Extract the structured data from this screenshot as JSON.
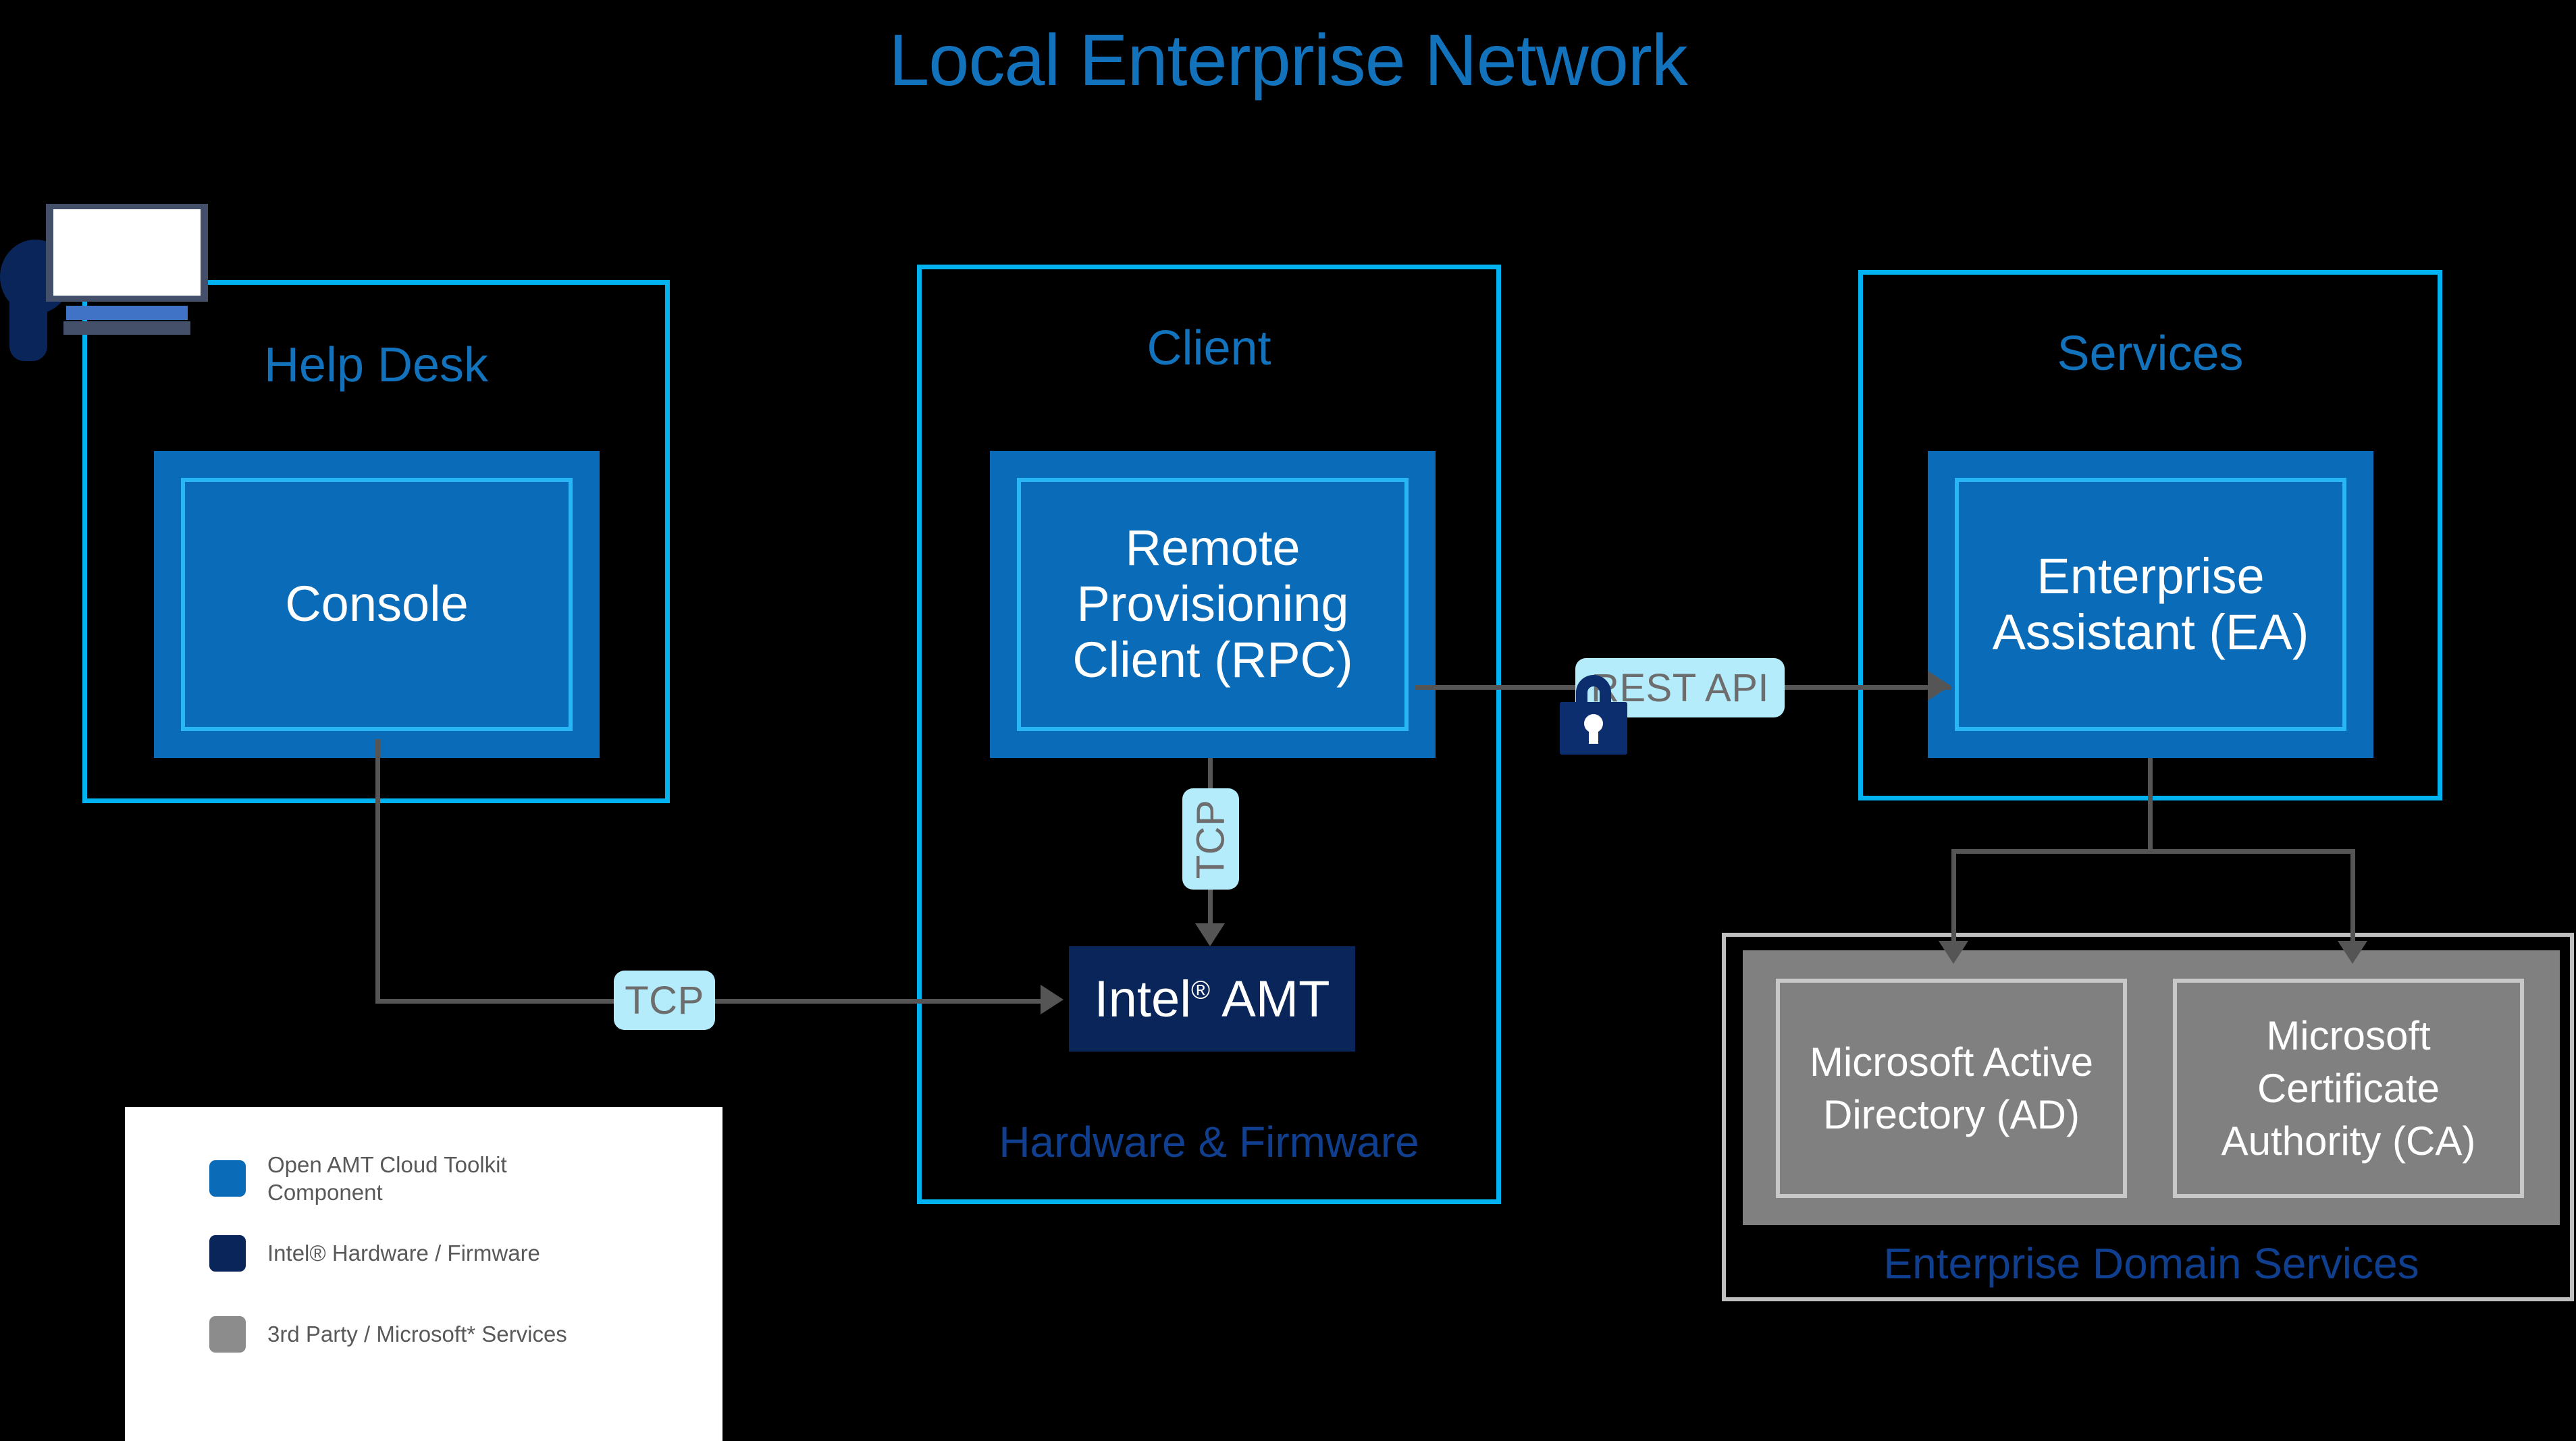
{
  "title": "Local Enterprise Network",
  "zones": {
    "help_desk": {
      "title": "Help Desk",
      "console": {
        "label": "Console"
      }
    },
    "client": {
      "title": "Client",
      "footer": "Hardware & Firmware",
      "rpc": {
        "label": "Remote Provisioning Client (RPC)"
      },
      "amt": {
        "label_prefix": "Intel",
        "label_reg": "®",
        "label_suffix": " AMT"
      }
    },
    "services": {
      "title": "Services",
      "ea": {
        "label": "Enterprise Assistant (EA)"
      }
    },
    "enterprise_domain_services": {
      "footer": "Enterprise Domain Services",
      "boxes": [
        {
          "label": "Microsoft Active Directory (AD)"
        },
        {
          "label": "Microsoft Certificate Authority (CA)"
        }
      ]
    }
  },
  "connectors": [
    {
      "name": "console-to-amt",
      "badge": "TCP",
      "orientation": "horizontal"
    },
    {
      "name": "rpc-to-amt",
      "badge": "TCP",
      "orientation": "vertical"
    },
    {
      "name": "rpc-to-ea",
      "badge": "REST API",
      "orientation": "horizontal",
      "secured": true
    }
  ],
  "legend": {
    "items": [
      {
        "color": "#0a6cb8",
        "label_line1": "Open AMT Cloud Toolkit",
        "label_line2": "Component"
      },
      {
        "color": "#0a2559",
        "label_line1": "Intel® Hardware / Firmware",
        "label_line2": ""
      },
      {
        "color": "#8c8c8c",
        "label_line1": "3rd Party / Microsoft* Services",
        "label_line2": ""
      }
    ]
  },
  "colors": {
    "background": "#000000",
    "zone_border": "#00b2f0",
    "zone_title": "#1272bb",
    "toolkit_blue": "#0a6cb8",
    "toolkit_inner_border": "#29b6f6",
    "hardware_navy": "#0a2559",
    "third_party_gray": "#808080",
    "badge_bg": "#b5ecfb",
    "badge_text": "#6d6d6d",
    "connector": "#555555",
    "footer_text": "#103f8f"
  }
}
